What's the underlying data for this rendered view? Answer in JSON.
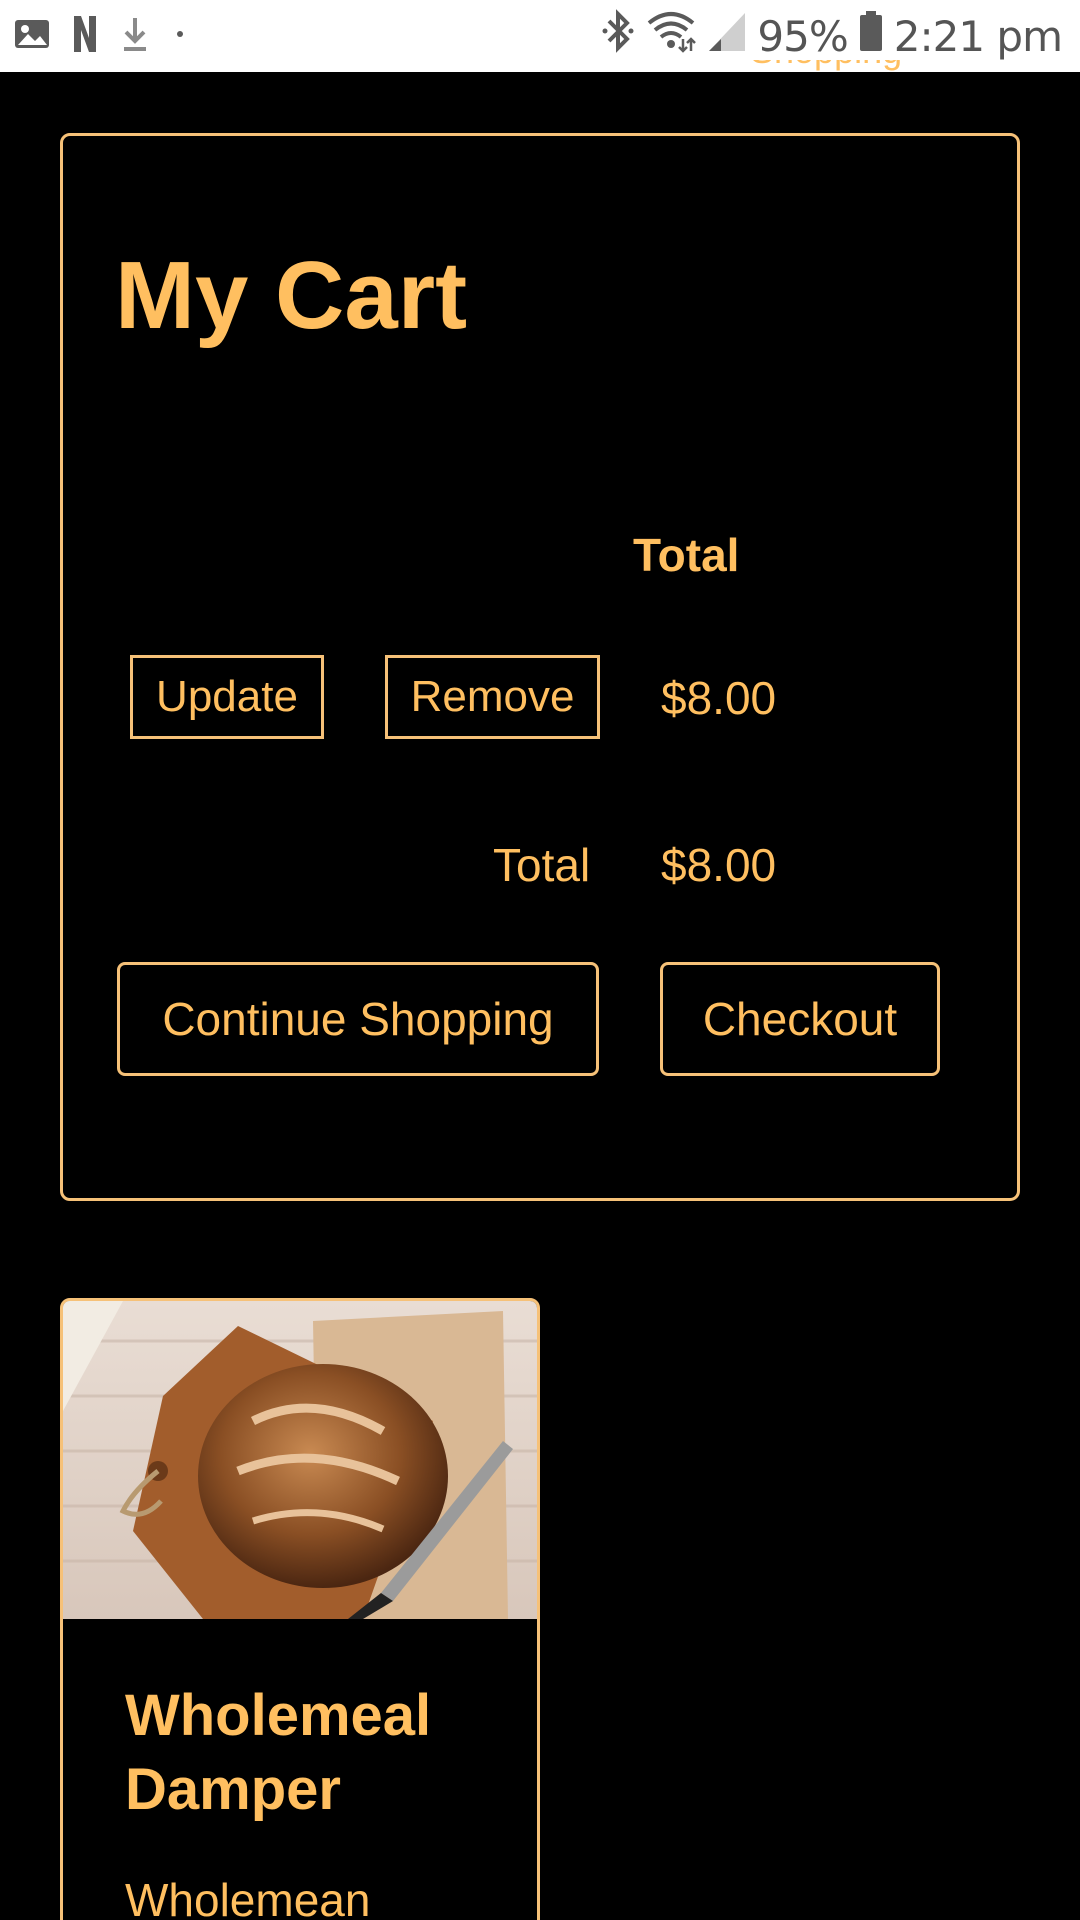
{
  "status_bar": {
    "battery": "95%",
    "time": "2:21 pm",
    "left_icons": [
      "image-icon",
      "netflix-n-icon",
      "download-icon",
      "dot-icon"
    ],
    "right_icons": [
      "bluetooth-icon",
      "wifi-icon",
      "signal-icon",
      "battery-icon"
    ]
  },
  "header_peek": {
    "text": "Shopping"
  },
  "cart": {
    "title": "My Cart",
    "column_header": "Total",
    "row": {
      "update_label": "Update",
      "remove_label": "Remove",
      "price": "$8.00"
    },
    "summary": {
      "label": "Total",
      "value": "$8.00"
    },
    "continue_label": "Continue Shopping",
    "checkout_label": "Checkout"
  },
  "product": {
    "name": "Wholemeal Damper",
    "description": "Wholemean",
    "image": "bread-loaf-photo"
  },
  "colors": {
    "accent": "#ffbf60",
    "border": "#f6c178",
    "background": "#000000",
    "statusbar": "#ffffff"
  }
}
